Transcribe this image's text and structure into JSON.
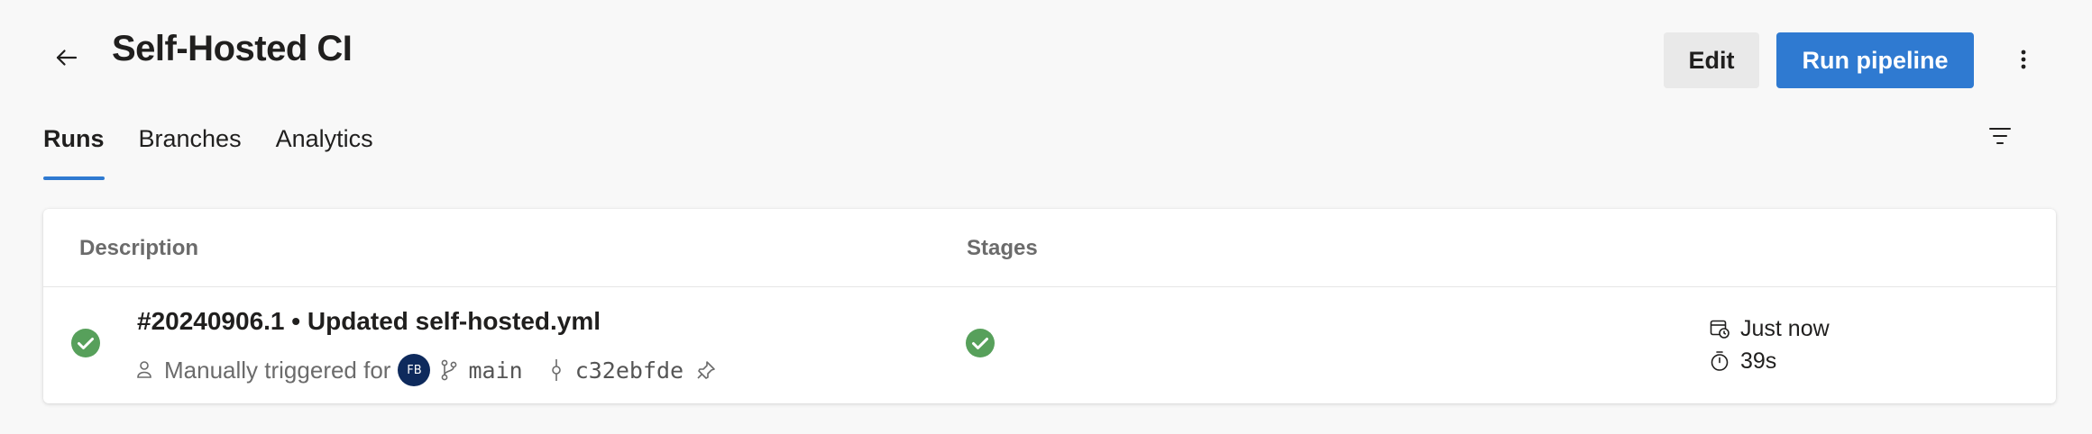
{
  "header": {
    "title": "Self-Hosted CI",
    "edit_label": "Edit",
    "run_label": "Run pipeline",
    "colors": {
      "primary": "#2f7ad1"
    }
  },
  "tabs": [
    {
      "label": "Runs",
      "active": true
    },
    {
      "label": "Branches",
      "active": false
    },
    {
      "label": "Analytics",
      "active": false
    }
  ],
  "table": {
    "columns": [
      "Description",
      "Stages"
    ],
    "runs": [
      {
        "title": "#20240906.1 • Updated self-hosted.yml",
        "trigger": "Manually triggered for",
        "avatar_initials": "FB",
        "branch": "main",
        "commit": "c32ebfde",
        "status": "succeeded",
        "status_color": "#57a05b",
        "time": "Just now",
        "duration": "39s"
      }
    ]
  }
}
